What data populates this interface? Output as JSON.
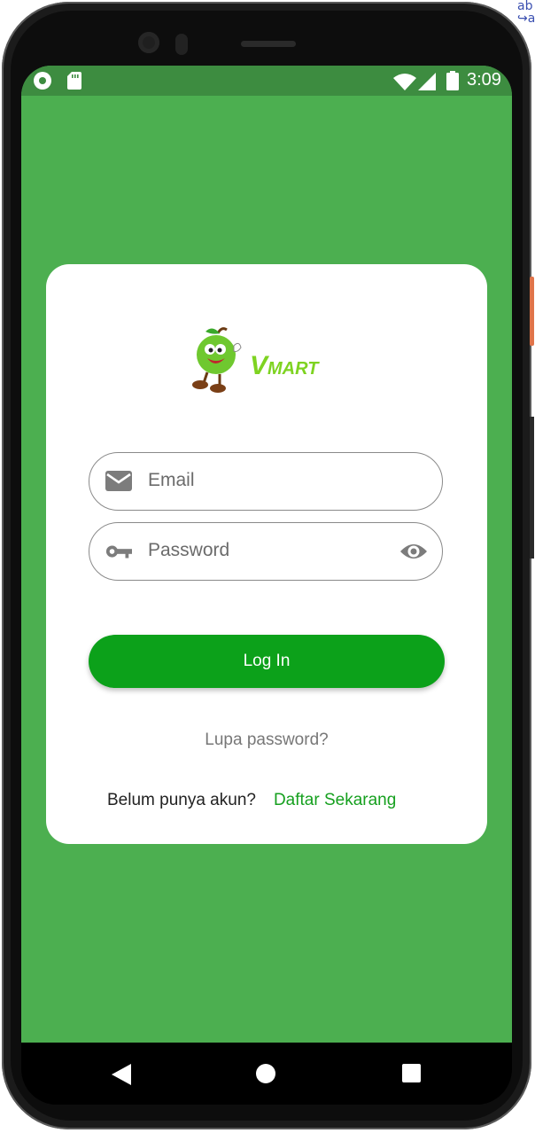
{
  "status_bar": {
    "time": "3:09",
    "icons": [
      "record-icon",
      "sd-card-icon",
      "wifi-icon",
      "signal-icon",
      "battery-icon"
    ]
  },
  "brand": {
    "name_v": "V",
    "name_mart": "MART",
    "accent": "#7ed321"
  },
  "login_form": {
    "email_placeholder": "Email",
    "password_placeholder": "Password",
    "login_label": "Log In",
    "forgot_label": "Lupa password?",
    "signup_question": "Belum punya akun?",
    "signup_link": "Daftar Sekarang"
  },
  "colors": {
    "screen_background": "#4caf50",
    "primary_button": "#0ca11a",
    "link": "#16a01f"
  },
  "nav_bar": {
    "icons": [
      "back-icon",
      "home-icon",
      "recents-icon"
    ]
  }
}
